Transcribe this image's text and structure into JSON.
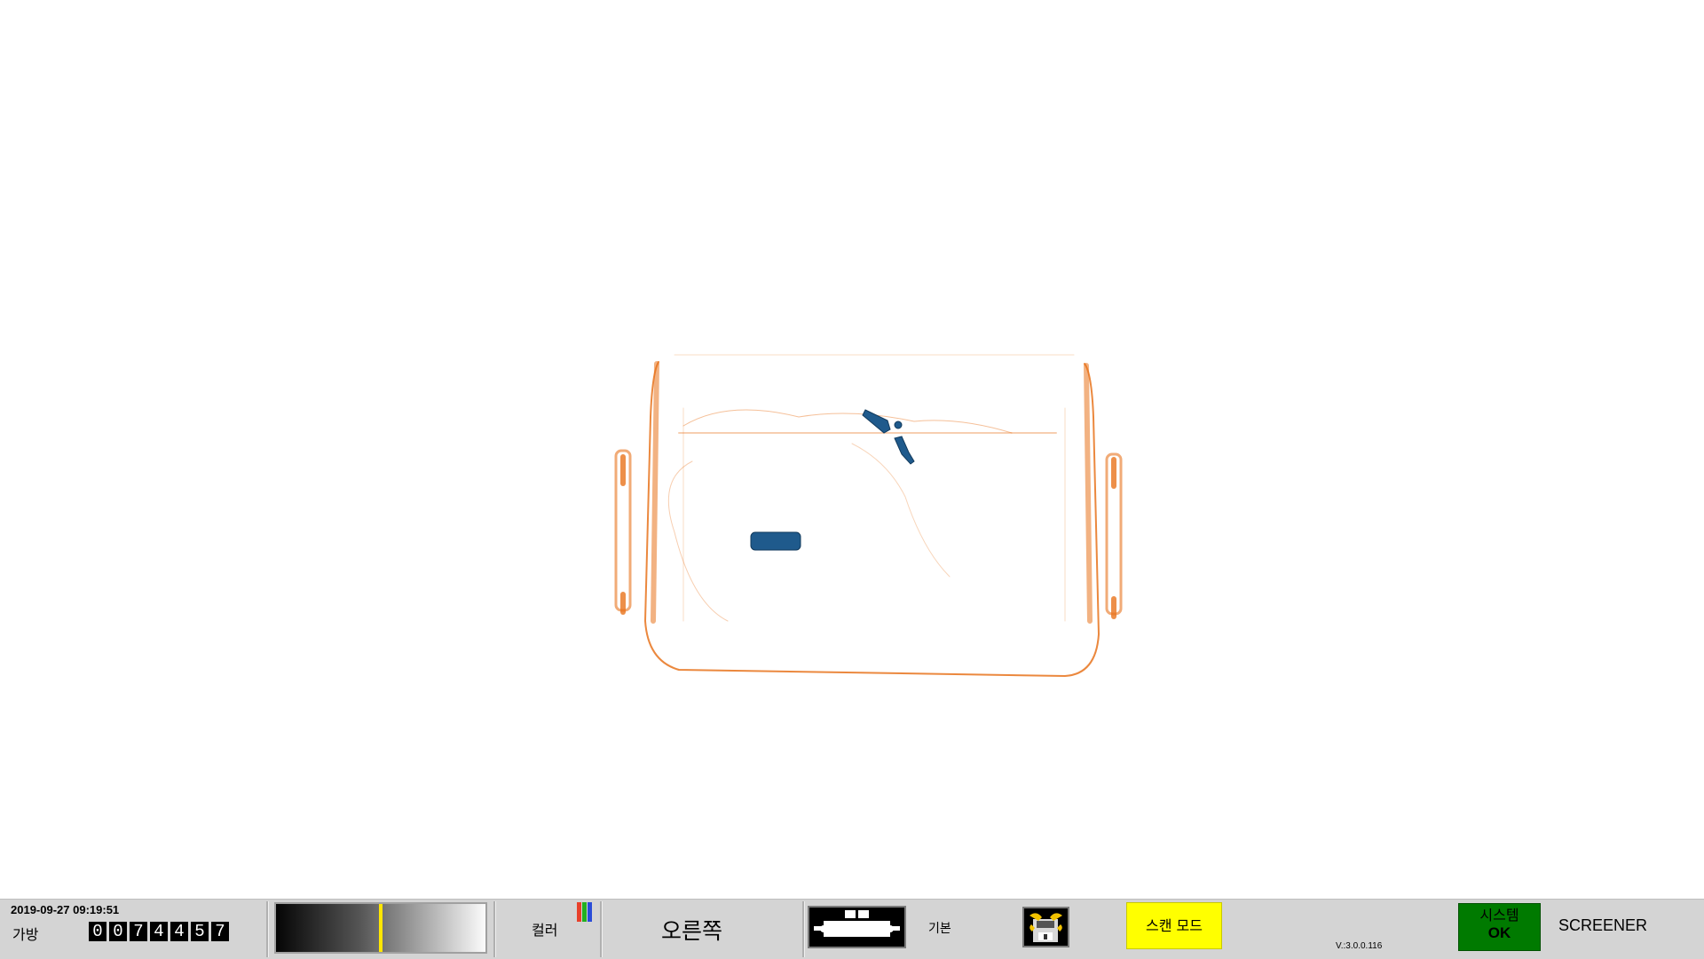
{
  "status_bar": {
    "datetime": "2019-09-27 09:19:51",
    "bag_label": "가방",
    "bag_counter_digits": [
      "0",
      "0",
      "7",
      "4",
      "4",
      "5",
      "7"
    ],
    "gradient_level": 0.5,
    "color_label": "컬러",
    "color_bar_colors": [
      "#e8402a",
      "#23b020",
      "#2a4cd8"
    ],
    "direction_label": "오른쪽",
    "conveyor_icon": "conveyor-belt-icon",
    "basic_label": "기본",
    "save_icon": "save-disk-icon",
    "scan_mode_label": "스캔 모드",
    "version": "V.:3.0.0.116",
    "system": {
      "title": "시스템",
      "status": "OK",
      "status_color": "#007a00"
    },
    "role": "SCREENER"
  },
  "viewer": {
    "organic_color": "#e8731c",
    "metal_color": "#1f5a8c"
  }
}
